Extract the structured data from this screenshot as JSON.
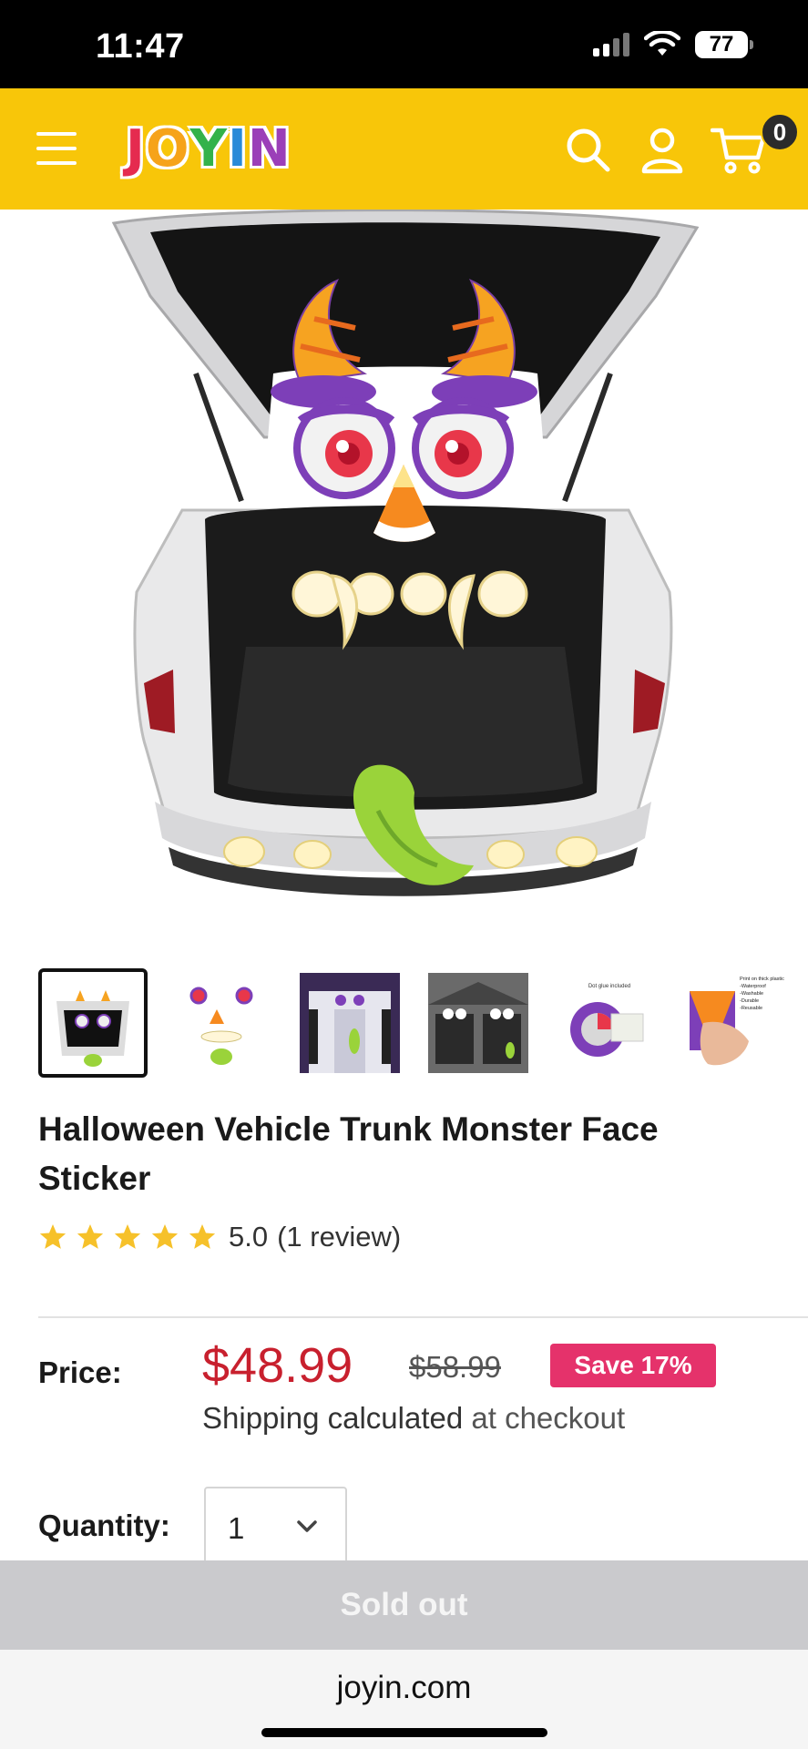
{
  "status_bar": {
    "time": "11:47",
    "battery": "77",
    "icons": [
      "signal-icon",
      "wifi-icon",
      "battery-icon"
    ]
  },
  "header": {
    "menu_icon": "hamburger-menu-icon",
    "logo_letters": [
      "J",
      "O",
      "Y",
      "I",
      "N"
    ],
    "search_icon": "search-icon",
    "account_icon": "user-icon",
    "cart_icon": "cart-icon",
    "cart_count": "0"
  },
  "product": {
    "title": "Halloween Vehicle Trunk Monster Face Sticker",
    "rating_value": "5.0",
    "review_text": "(1 review)",
    "stars": 5,
    "price_label": "Price:",
    "price_current": "$48.99",
    "price_original": "$58.99",
    "save_badge": "Save 17%",
    "shipping_prefix": "Shipping calculated",
    "shipping_link": "at checkout",
    "quantity_label": "Quantity:",
    "quantity_value": "1",
    "sold_out_label": "Sold out",
    "thumbnail_count": 6,
    "thumb5_caption": "Dot glue included",
    "thumb6_caption": [
      "Print on thick plastic",
      "-Waterproof",
      "-Washable",
      "-Durable",
      "-Reusable"
    ]
  },
  "colors": {
    "header_bg": "#f8c609",
    "price_red": "#c8202e",
    "save_pink": "#e5326b",
    "star_yellow": "#f6c12a",
    "soldout_gray": "#cacacd"
  },
  "browser": {
    "url": "joyin.com"
  }
}
